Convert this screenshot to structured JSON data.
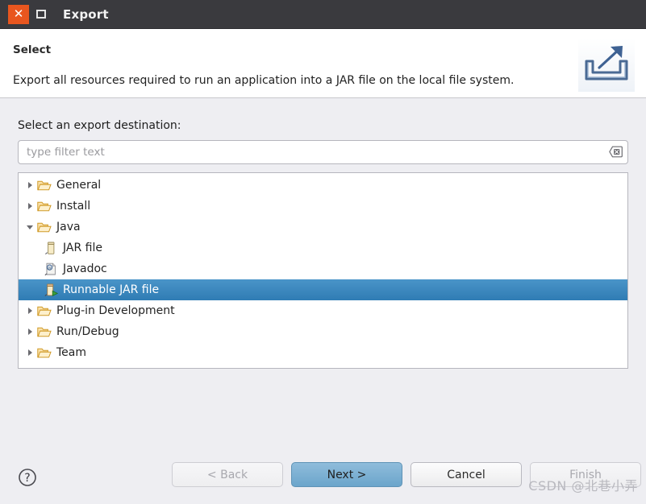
{
  "window": {
    "title": "Export",
    "close_label": "✕",
    "maximize_name": "maximize-button"
  },
  "header": {
    "title": "Select",
    "description": "Export all resources required to run an application into a JAR file on the local file system.",
    "icon": "export-icon"
  },
  "main": {
    "destination_label": "Select an export destination:",
    "filter": {
      "value": "",
      "placeholder": "type filter text",
      "clear_icon": "clear-icon"
    },
    "tree": [
      {
        "label": "General",
        "level": 0,
        "expanded": false,
        "icon": "folder-icon",
        "selected": false
      },
      {
        "label": "Install",
        "level": 0,
        "expanded": false,
        "icon": "folder-icon",
        "selected": false
      },
      {
        "label": "Java",
        "level": 0,
        "expanded": true,
        "icon": "folder-icon",
        "selected": false
      },
      {
        "label": "JAR file",
        "level": 1,
        "expanded": null,
        "icon": "jar-icon",
        "selected": false
      },
      {
        "label": "Javadoc",
        "level": 1,
        "expanded": null,
        "icon": "javadoc-icon",
        "selected": false
      },
      {
        "label": "Runnable JAR file",
        "level": 1,
        "expanded": null,
        "icon": "runnable-jar-icon",
        "selected": true
      },
      {
        "label": "Plug-in Development",
        "level": 0,
        "expanded": false,
        "icon": "folder-icon",
        "selected": false
      },
      {
        "label": "Run/Debug",
        "level": 0,
        "expanded": false,
        "icon": "folder-icon",
        "selected": false
      },
      {
        "label": "Team",
        "level": 0,
        "expanded": false,
        "icon": "folder-icon",
        "selected": false
      }
    ]
  },
  "footer": {
    "help_icon": "help-icon",
    "buttons": [
      {
        "label": "< Back",
        "name": "back-button",
        "state": "disabled"
      },
      {
        "label": "Next >",
        "name": "next-button",
        "state": "primary"
      },
      {
        "label": "Cancel",
        "name": "cancel-button",
        "state": "normal"
      },
      {
        "label": "Finish",
        "name": "finish-button",
        "state": "disabled"
      }
    ]
  },
  "watermark": "CSDN @北巷小弄",
  "colors": {
    "titlebar": "#3a3a3e",
    "close_button": "#e8561f",
    "selection": "#2f7cb4",
    "primary_button": "#6ba5cb",
    "body": "#eeeef2"
  }
}
